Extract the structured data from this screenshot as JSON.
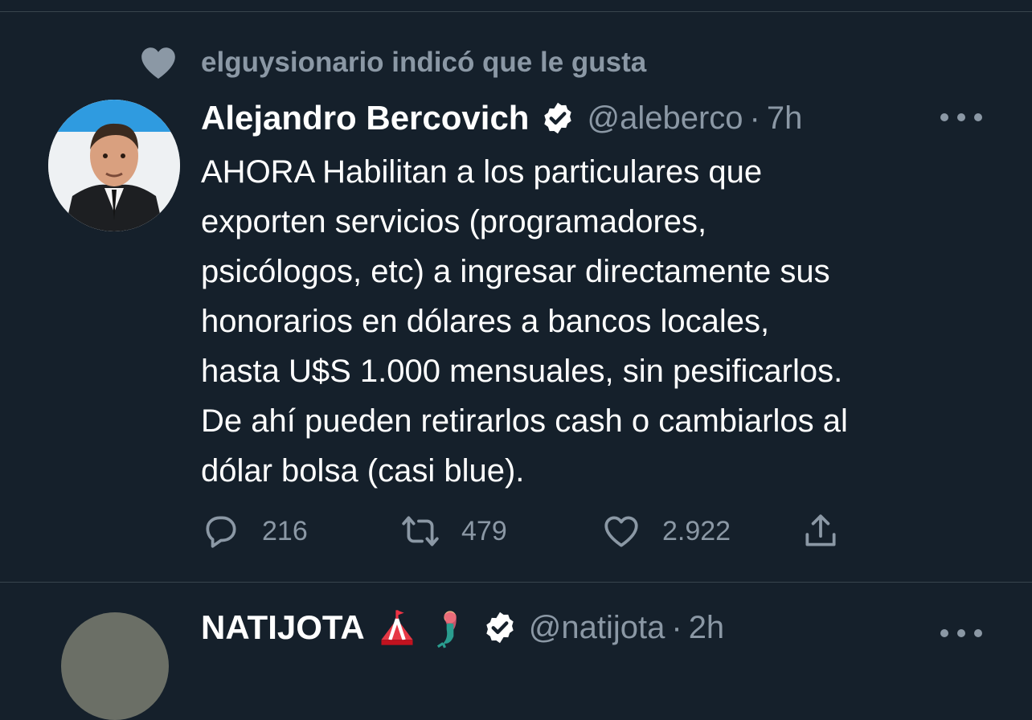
{
  "social_context": {
    "text": "elguysionario indicó que le gusta",
    "icon": "heart-filled-icon"
  },
  "tweet": {
    "author_name": "Alejandro Bercovich",
    "verified": true,
    "handle": "@aleberco",
    "separator": "·",
    "time": "7h",
    "body_lines": [
      "AHORA Habilitan a los particulares que",
      "exporten servicios (programadores,",
      "psicólogos, etc) a ingresar directamente sus",
      "honorarios en dólares a bancos locales,",
      "hasta U$S 1.000 mensuales, sin pesificarlos.",
      "De ahí pueden retirarlos cash o cambiarlos al",
      "dólar bolsa (casi blue)."
    ],
    "actions": {
      "reply": {
        "count": "216",
        "icon": "reply-icon"
      },
      "retweet": {
        "count": "479",
        "icon": "retweet-icon"
      },
      "like": {
        "count": "2.922",
        "icon": "like-icon"
      },
      "share": {
        "icon": "share-icon"
      }
    }
  },
  "next_tweet": {
    "author_name": "NATIJOTA",
    "emojis": [
      "circus-tent-emoji",
      "mermaid-emoji"
    ],
    "verified": true,
    "handle": "@natijota",
    "separator": "·",
    "time": "2h"
  },
  "colors": {
    "background": "#15202b",
    "secondary_text": "#8b98a5",
    "primary_text": "#ffffff",
    "divider": "#38444d"
  }
}
